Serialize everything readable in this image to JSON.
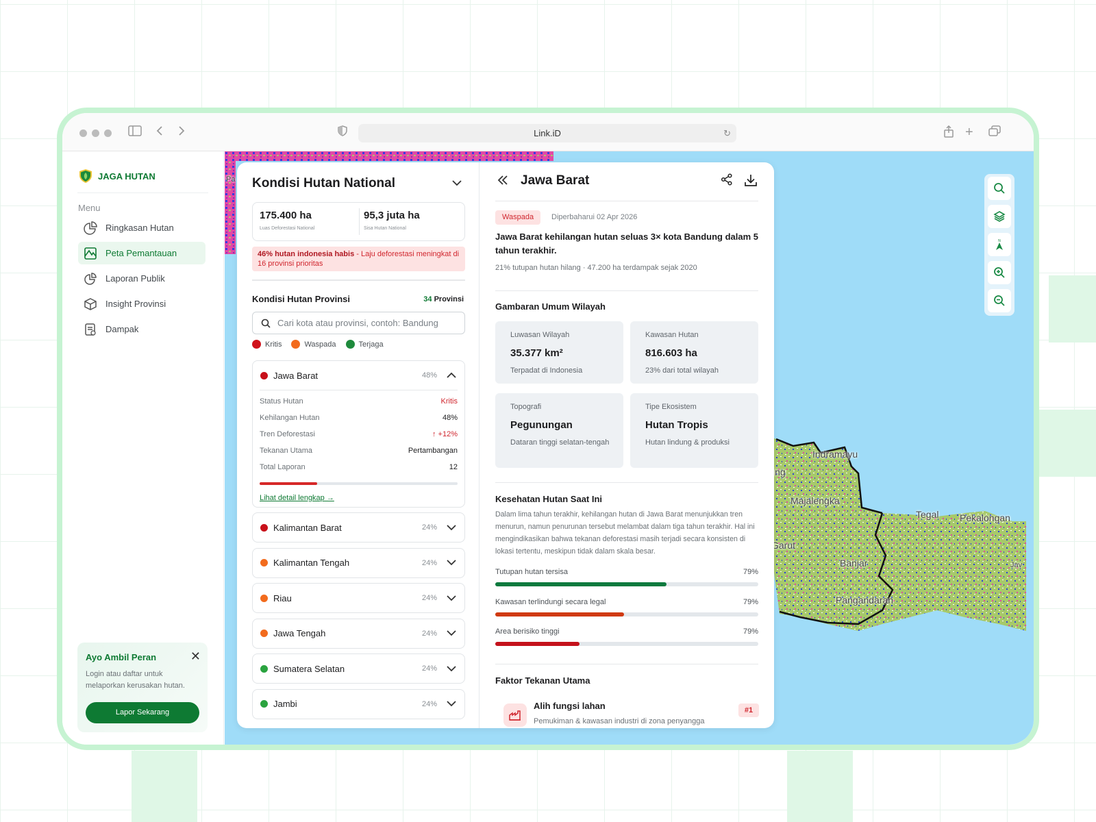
{
  "browser": {
    "url": "Link.iD"
  },
  "sidebar": {
    "brand": "JAGA HUTAN",
    "menu_label": "Menu",
    "items": [
      {
        "label": "Ringkasan Hutan",
        "icon": "pie-chart-icon"
      },
      {
        "label": "Peta Pemantauan",
        "icon": "map-icon"
      },
      {
        "label": "Laporan Publik",
        "icon": "report-chart-icon"
      },
      {
        "label": "Insight Provinsi",
        "icon": "box-icon"
      },
      {
        "label": "Dampak",
        "icon": "document-icon"
      }
    ],
    "active": "Peta Pemantauan",
    "cta": {
      "title": "Ayo Ambil Peran",
      "text": "Login atau daftar untuk melaporkan kerusakan hutan.",
      "button": "Lapor Sekarang"
    }
  },
  "national": {
    "title": "Kondisi Hutan National",
    "stats": [
      {
        "value": "175.400 ha",
        "label": "Luas Deforestasi National"
      },
      {
        "value": "95,3 juta ha",
        "label": "Sisa Hutan National"
      }
    ],
    "alert_bold": "46% hutan indonesia habis",
    "alert_text": " - Laju deforestasi meningkat di 16 provinsi prioritas"
  },
  "provinces": {
    "title": "Kondisi Hutan Provinsi",
    "count_num": "34",
    "count_label": "Provinsi",
    "search_placeholder": "Cari kota atau provinsi, contoh: Bandung",
    "legend": [
      {
        "label": "Kritis",
        "color": "#d0121b"
      },
      {
        "label": "Waspada",
        "color": "#f26b1d"
      },
      {
        "label": "Terjaga",
        "color": "#1e8a3c"
      }
    ],
    "expanded": {
      "name": "Jawa Barat",
      "pct": "48%",
      "color": "#c8101a",
      "rows": [
        {
          "label": "Status Hutan",
          "value": "Kritis"
        },
        {
          "label": "Kehilangan Hutan",
          "value": "48%"
        },
        {
          "label": "Tren Deforestasi",
          "value": "↑ +12%"
        },
        {
          "label": "Tekanan Utama",
          "value": "Pertambangan"
        },
        {
          "label": "Total Laporan",
          "value": "12"
        }
      ],
      "bar_fraction": 0.29,
      "link": "Lihat detail lengkap →"
    },
    "list": [
      {
        "name": "Kalimantan Barat",
        "pct": "24%",
        "color": "#c8101a"
      },
      {
        "name": "Kalimantan Tengah",
        "pct": "24%",
        "color": "#f26b1d"
      },
      {
        "name": "Riau",
        "pct": "24%",
        "color": "#f26b1d"
      },
      {
        "name": "Jawa Tengah",
        "pct": "24%",
        "color": "#f26b1d"
      },
      {
        "name": "Sumatera Selatan",
        "pct": "24%",
        "color": "#2aa33f"
      },
      {
        "name": "Jambi",
        "pct": "24%",
        "color": "#2aa33f"
      }
    ]
  },
  "detail": {
    "title": "Jawa Barat",
    "badge": "Waspada",
    "updated": "Diperbaharui 02 Apr 2026",
    "headline": "Jawa Barat kehilangan hutan seluas 3× kota Bandung dalam 5 tahun terakhir.",
    "subline": "21% tutupan hutan hilang · 47.200 ha terdampak sejak 2020",
    "overview_title": "Gambaran Umum Wilayah",
    "cards": [
      {
        "title": "Luwasan Wilayah",
        "value": "35.377 km²",
        "desc": "Terpadat di Indonesia"
      },
      {
        "title": "Kawasan Hutan",
        "value": "816.603 ha",
        "desc": "23% dari total wilayah"
      },
      {
        "title": "Topografi",
        "value": "Pegunungan",
        "desc": "Dataran tinggi selatan-tengah"
      },
      {
        "title": "Tipe Ekosistem",
        "value": "Hutan Tropis",
        "desc": "Hutan lindung & produksi"
      }
    ],
    "health_title": "Kesehatan Hutan Saat Ini",
    "health_text": "Dalam lima tahun terakhir, kehilangan hutan di Jawa Barat menunjukkan tren menurun, namun penurunan tersebut melambat dalam tiga tahun terakhir. Hal ini mengindikasikan bahwa tekanan deforestasi masih terjadi secara konsisten di lokasi tertentu, meskipun tidak dalam skala besar.",
    "health_bars": [
      {
        "label": "Tutupan hutan tersisa",
        "value": "79%",
        "fraction": 0.65,
        "color": "#0d7a3e"
      },
      {
        "label": "Kawasan terlindungi secara legal",
        "value": "79%",
        "fraction": 0.49,
        "color": "#d03a10"
      },
      {
        "label": "Area berisiko tinggi",
        "value": "79%",
        "fraction": 0.32,
        "color": "#c4121c"
      }
    ],
    "factor_title": "Faktor Tekanan Utama",
    "factor": {
      "name": "Alih fungsi lahan",
      "desc": "Pemukiman & kawasan industri di zona penyangga",
      "rank": "#1"
    }
  },
  "map": {
    "labels": [
      "Indramayu",
      "Majalengka",
      "Tegal",
      "Pekalongan",
      "Garut",
      "Banjar",
      "Pangandaran",
      "ing",
      "Jav",
      "Pa"
    ],
    "tools": [
      "search-icon",
      "layers-icon",
      "north-arrow-icon",
      "zoom-in-icon",
      "zoom-out-icon"
    ]
  }
}
